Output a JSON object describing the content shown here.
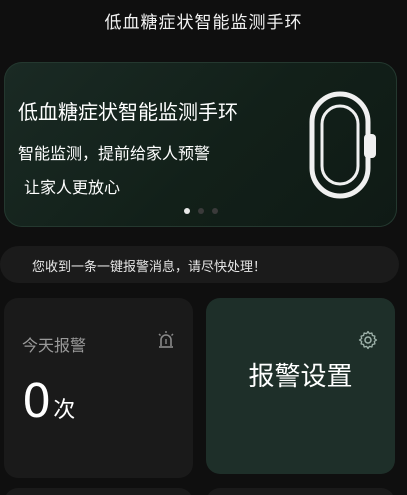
{
  "header": {
    "title": "低血糖症状智能监测手环"
  },
  "banner": {
    "title": "低血糖症状智能监测手环",
    "line1": "智能监测，提前给家人预警",
    "line2": "让家人更放心",
    "image_icon": "bracelet-icon",
    "pager": {
      "total": 3,
      "active_index": 0
    }
  },
  "notice": {
    "text": "您收到一条一键报警消息，请尽快处理！"
  },
  "today_card": {
    "label": "今天报警",
    "icon": "alarm-light-icon",
    "count": "0",
    "unit": "次"
  },
  "settings_card": {
    "label": "报警设置",
    "icon": "gear-icon"
  },
  "colors": {
    "background": "#0f0f0f",
    "banner_bg": "#122019",
    "card_bg": "#1a1a1a",
    "settings_bg": "#1e2f29"
  }
}
